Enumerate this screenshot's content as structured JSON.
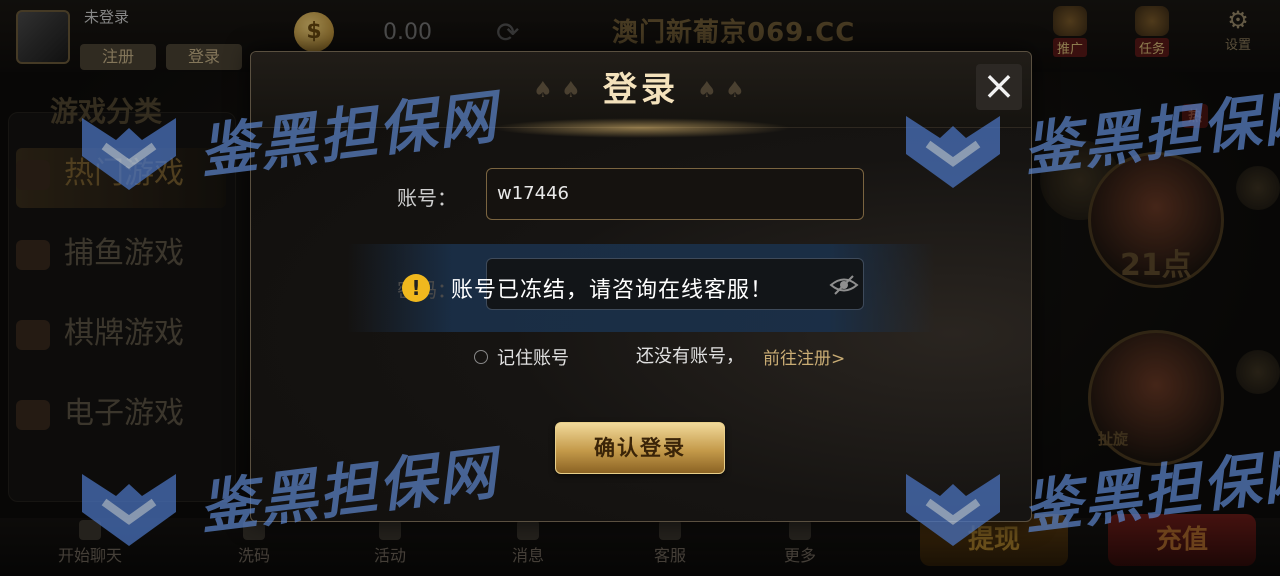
{
  "top": {
    "user_name": "未登录",
    "register_btn": "注册",
    "login_btn": "登录",
    "balance": "0.00",
    "brand": "澳门新葡京069.CC",
    "promo_label": "推广",
    "task_label": "任务",
    "settings_label": "设置"
  },
  "sidebar": {
    "title": "游戏分类",
    "items": [
      {
        "label": "热门游戏"
      },
      {
        "label": "捕鱼游戏"
      },
      {
        "label": "棋牌游戏"
      },
      {
        "label": "电子游戏"
      }
    ]
  },
  "games": {
    "blackjack_label": "21点",
    "card_label": "扯旋",
    "badge": "热"
  },
  "bottom": {
    "items": [
      {
        "label": "开始聊天"
      },
      {
        "label": "洗码"
      },
      {
        "label": "活动"
      },
      {
        "label": "消息"
      },
      {
        "label": "客服"
      },
      {
        "label": "更多"
      }
    ],
    "withdraw_label": "提现",
    "recharge_label": "充值"
  },
  "watermark": {
    "text": "鉴黑担保网"
  },
  "modal": {
    "title": "登录",
    "account_label": "账号：",
    "account_value": "w17446",
    "password_label": "密码：",
    "toast": "账号已冻结，请咨询在线客服！",
    "remember_label": "记住账号",
    "no_account_text": "还没有账号，",
    "register_link": "前往注册>",
    "confirm_button": "确认登录"
  },
  "colors": {
    "gold_accent": "#c9ac74",
    "title_text": "#f4e2bc",
    "toast_bg": "#1a304a",
    "warning": "#f0b81e",
    "watermark_blue": "#5b83c8"
  },
  "icons": {
    "close": "close-icon",
    "warning": "warning-icon",
    "eye": "eye-hidden-icon",
    "coin": "coin-icon",
    "refresh": "refresh-icon",
    "settings": "gear-icon"
  }
}
